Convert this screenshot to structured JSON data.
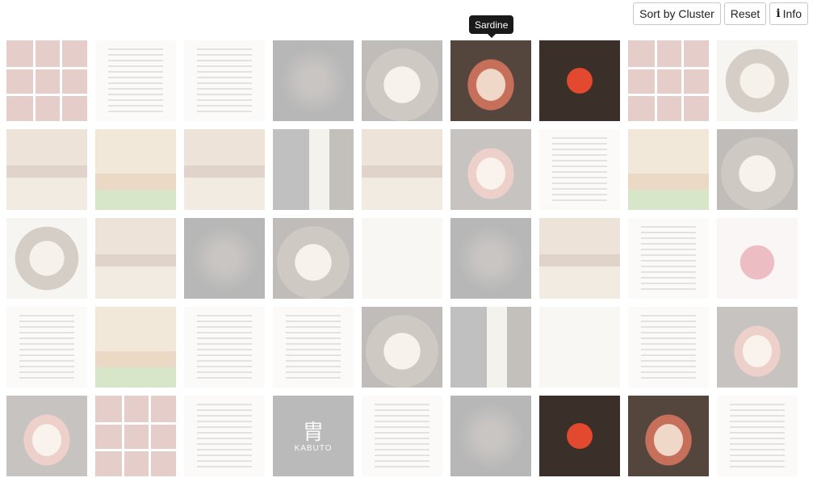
{
  "toolbar": {
    "sort_label": "Sort by Cluster",
    "reset_label": "Reset",
    "info_label": "Info"
  },
  "tooltip": {
    "text": "Sardine"
  },
  "tiles": [
    {
      "kind": "collage"
    },
    {
      "kind": "menu"
    },
    {
      "kind": "menu"
    },
    {
      "kind": "dark"
    },
    {
      "kind": "plate"
    },
    {
      "kind": "fish",
      "active": true
    },
    {
      "kind": "red",
      "active": true
    },
    {
      "kind": "collage"
    },
    {
      "kind": "bowl"
    },
    {
      "kind": "kitchen"
    },
    {
      "kind": "glass"
    },
    {
      "kind": "kitchen"
    },
    {
      "kind": "bottle"
    },
    {
      "kind": "kitchen"
    },
    {
      "kind": "fish"
    },
    {
      "kind": "menu"
    },
    {
      "kind": "glass"
    },
    {
      "kind": "plate"
    },
    {
      "kind": "bowl"
    },
    {
      "kind": "kitchen"
    },
    {
      "kind": "dark"
    },
    {
      "kind": "plate"
    },
    {
      "kind": "light"
    },
    {
      "kind": "dark"
    },
    {
      "kind": "kitchen"
    },
    {
      "kind": "menu"
    },
    {
      "kind": "tuna"
    },
    {
      "kind": "menu"
    },
    {
      "kind": "glass"
    },
    {
      "kind": "menu"
    },
    {
      "kind": "menu"
    },
    {
      "kind": "plate"
    },
    {
      "kind": "bottle"
    },
    {
      "kind": "light"
    },
    {
      "kind": "menu"
    },
    {
      "kind": "fish"
    },
    {
      "kind": "fish"
    },
    {
      "kind": "collage"
    },
    {
      "kind": "menu"
    },
    {
      "kind": "logo",
      "logo_text": "KABUTO"
    },
    {
      "kind": "menu"
    },
    {
      "kind": "dark"
    },
    {
      "kind": "red",
      "active": true
    },
    {
      "kind": "fish",
      "active": true
    },
    {
      "kind": "menu"
    }
  ]
}
